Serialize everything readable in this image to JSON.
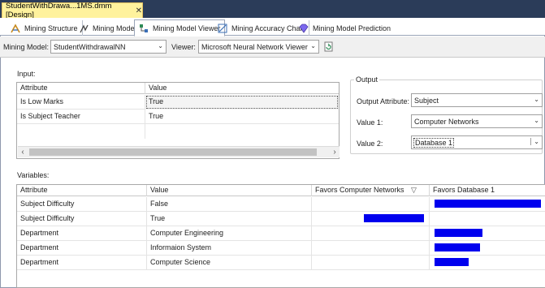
{
  "document_tab": {
    "title": "StudentWithDrawa...1MS.dmm [Design]",
    "close": "✕"
  },
  "view_tabs": [
    {
      "label": "Mining Structure",
      "icon": "mining-structure-icon",
      "active": false
    },
    {
      "label": "Mining Models",
      "icon": "mining-models-icon",
      "active": false
    },
    {
      "label": "Mining Model Viewer",
      "icon": "mining-model-viewer-icon",
      "active": true
    },
    {
      "label": "Mining Accuracy Chart",
      "icon": "accuracy-chart-icon",
      "active": false
    },
    {
      "label": "Mining Model Prediction",
      "icon": "prediction-gem-icon",
      "active": false
    }
  ],
  "toolbar": {
    "model_label": "Mining Model:",
    "model_value": "StudentWithdrawalNN",
    "viewer_label": "Viewer:",
    "viewer_value": "Microsoft Neural Network Viewer",
    "refresh_icon": "refresh-document-icon"
  },
  "input": {
    "label": "Input:",
    "columns": [
      "Attribute",
      "Value"
    ],
    "rows": [
      {
        "attribute": "Is Low Marks",
        "value": "True"
      },
      {
        "attribute": "Is Subject Teacher",
        "value": "True"
      }
    ]
  },
  "output": {
    "label": "Output",
    "attribute_label": "Output Attribute:",
    "attribute_value": "Subject",
    "value1_label": "Value 1:",
    "value1": "Computer Networks",
    "value2_label": "Value 2:",
    "value2": "Database 1"
  },
  "variables": {
    "label": "Variables:",
    "columns": [
      "Attribute",
      "Value",
      "Favors Computer Networks",
      "Favors Database 1"
    ],
    "sort_glyph": "▽",
    "rows": [
      {
        "attribute": "Subject Difficulty",
        "value": "False",
        "favors_cn": 0,
        "favors_db": 1.0
      },
      {
        "attribute": "Subject Difficulty",
        "value": "True",
        "favors_cn": 0.53,
        "favors_db": 0
      },
      {
        "attribute": "Department",
        "value": "Computer Engineering",
        "favors_cn": 0,
        "favors_db": 0.45
      },
      {
        "attribute": "Department",
        "value": "Informaion System",
        "favors_cn": 0,
        "favors_db": 0.43
      },
      {
        "attribute": "Department",
        "value": "Computer Science",
        "favors_cn": 0,
        "favors_db": 0.32
      }
    ]
  },
  "colors": {
    "bar": "#0000ee",
    "tab_strip": "#2b3c59",
    "active_doc_tab": "#fff29d"
  }
}
